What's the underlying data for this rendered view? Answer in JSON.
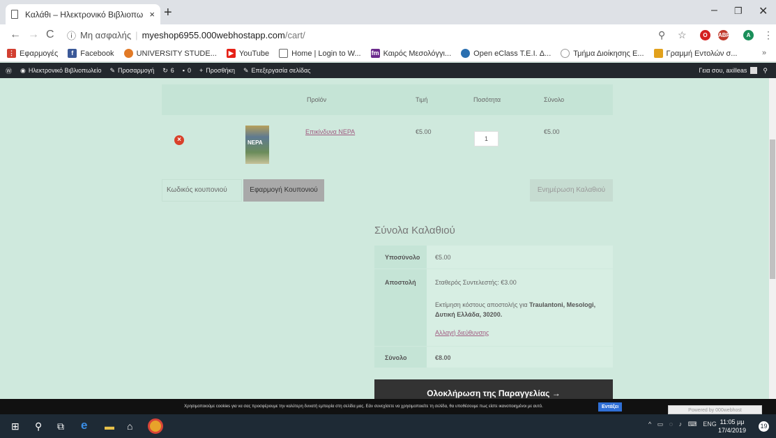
{
  "browser": {
    "tab_title": "Καλάθι – Ηλεκτρονικό Βιβλιοπω",
    "new_tab": "+",
    "security": "Μη ασφαλής",
    "url_host": "myeshop6955.000webhostapp.com",
    "url_path": "/cart/",
    "bookmarks": [
      {
        "label": "Εφαρμογές",
        "icon": "apps-icon",
        "color": "#d23f31"
      },
      {
        "label": "Facebook",
        "icon": "facebook-icon",
        "color": "#3b5998"
      },
      {
        "label": "UNIVERSITY STUDE...",
        "icon": "university-icon",
        "color": "#e27a26"
      },
      {
        "label": "YouTube",
        "icon": "youtube-icon",
        "color": "#e62117"
      },
      {
        "label": "Home | Login to W...",
        "icon": "page-icon",
        "color": "#888888"
      },
      {
        "label": "Καιρός Μεσολόγγι...",
        "icon": "fm-icon",
        "color": "#6b2a8c"
      },
      {
        "label": "Open eClass T.E.I. Δ...",
        "icon": "eclass-icon",
        "color": "#2a6fb0"
      },
      {
        "label": "Τμήμα Διοίκησης Ε...",
        "icon": "circle-icon",
        "color": "#999999"
      },
      {
        "label": "Γραμμή Εντολών σ...",
        "icon": "folder-icon",
        "color": "#e2a11c"
      }
    ],
    "more": "»"
  },
  "wp_admin": {
    "site": "Ηλεκτρονικό Βιβλιοπωλείο",
    "customize": "Προσαρμογή",
    "updates": "6",
    "comments": "0",
    "new": "Προσθήκη",
    "edit": "Επεξεργασία σελίδας",
    "greeting": "Γεια σου, axilleas"
  },
  "cart": {
    "headers": {
      "product": "Προϊόν",
      "price": "Τιμή",
      "quantity": "Ποσότητα",
      "total": "Σύνολο"
    },
    "item": {
      "name": "Επικίνδυνα ΝΕΡΑ",
      "book_cover_text": "ΝΕΡΑ",
      "price": "€5.00",
      "quantity": "1",
      "total": "€5.00"
    },
    "coupon_placeholder": "Κωδικός κουπονιού",
    "apply_coupon": "Εφαρμογή Κουπονιού",
    "update_cart": "Ενημέρωση Καλαθιού"
  },
  "totals": {
    "title": "Σύνολα Καλαθιού",
    "subtotal_label": "Υποσύνολο",
    "subtotal_value": "€5.00",
    "shipping_label": "Αποστολή",
    "shipping_rate": "Σταθερός Συντελεστής: €3.00",
    "shipping_estimate_prefix": "Εκτίμηση κόστους αποστολής για ",
    "shipping_estimate_location": "Traulantoni, Mesologi, Δυτική Ελλάδα, 30200.",
    "change_address": "Αλλαγή διεύθυνσης",
    "total_label": "Σύνολο",
    "total_value": "€8.00",
    "checkout": "Ολοκλήρωση της Παραγγελίας →"
  },
  "cookie_bar": {
    "text": "Χρησιμοποιούμε cookies για να σας προσφέρουμε την καλύτερη δυνατή εμπειρία στη σελίδα μας. Εάν συνεχίσετε να χρησιμοποιείτε τη σελίδα, θα υποθέσουμε πως είστε ικανοποιημένοι με αυτό.",
    "accept": "Εντάξει"
  },
  "powered_by": "Powered by 000webhost",
  "taskbar": {
    "lang": "ENG",
    "time": "11:05 μμ",
    "date": "17/4/2019",
    "notifications": "19"
  }
}
